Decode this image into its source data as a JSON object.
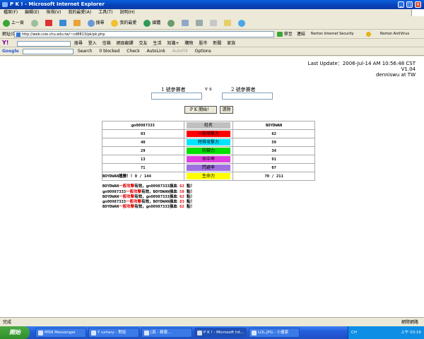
{
  "window": {
    "title": "P K ! - Microsoft Internet Explorer",
    "min": "_",
    "max": "□",
    "close": "×"
  },
  "menu": [
    "檔案(F)",
    "編輯(E)",
    "檢視(V)",
    "我的最愛(A)",
    "工具(T)",
    "說明(H)"
  ],
  "toolbar": {
    "back": "上一頁",
    "search": "搜尋",
    "favorites": "我的最愛",
    "media": "媒體"
  },
  "address": {
    "label": "網址(D)",
    "url": "http://web.csie.chu.edu.tw/~cd8813/pk/pk.php",
    "go": "移至",
    "links": "連結",
    "norton_security": "Norton Internet Security",
    "norton_av": "Norton AntiVirus"
  },
  "yahoo_bar": {
    "search": "搜尋",
    "signin": "登入",
    "mail": "信箱",
    "translate": "網頁翻譯",
    "shopping": "交友",
    "life": "生活",
    "knowledge": "知識+",
    "buy": "購物",
    "stock": "股市",
    "news": "新聞",
    "family": "家族"
  },
  "google_bar": {
    "label": "Google",
    "search": "Search",
    "blocked": "0 blocked",
    "check": "Check",
    "autolink": "AutoLink",
    "autofill": "AutoFill",
    "options": "Options"
  },
  "page": {
    "last_update": "Last Update：2006-Jul-14    AM 10:56:48 CST",
    "version": "V1.04",
    "author": "denniswu at TW",
    "p1_label": "1 號參賽者",
    "vs": "v s",
    "p2_label": "2 號參賽者",
    "pk_button": "P K 開始！",
    "clear_button": "清除",
    "table": {
      "header": {
        "p1": "gn00987333",
        "name": "姓名",
        "p2": "BOYDWAN"
      },
      "rows": [
        {
          "p1": "83",
          "attr": "一般攻擊力",
          "color": "#ff0000",
          "p2": "62"
        },
        {
          "p1": "40",
          "attr": "特殊攻擊力",
          "color": "#00e5ff",
          "p2": "59"
        },
        {
          "p1": "29",
          "attr": "防禦力",
          "color": "#00e000",
          "p2": "34"
        },
        {
          "p1": "13",
          "attr": "命中率",
          "color": "#e040e0",
          "p2": "91"
        },
        {
          "p1": "71",
          "attr": "閃避率",
          "color": "#a070e0",
          "p2": "07"
        },
        {
          "p1": "0  /  144",
          "attr": "生命力",
          "color": "#ffff00",
          "p2": "70  /  211"
        }
      ],
      "header_color": "#c0c0c0"
    },
    "winner": "BOYDWAN獲勝！！",
    "log": [
      {
        "a": "BOYDWAN",
        "b": "一般攻擊",
        "c": "有效，gn00987333損血",
        "d": "62",
        "e": "點！"
      },
      {
        "a": "gn00987333",
        "b": "一般攻擊",
        "c": "有效，BOYDWAN損血",
        "d": "58",
        "e": "點！"
      },
      {
        "a": "BOYDWAN",
        "b": "一般攻擊",
        "c": "有效，gn00987333損血",
        "d": "62",
        "e": "點！"
      },
      {
        "a": "gn00987333",
        "b": "一般攻擊",
        "c": "有效，BOYDWAN損血",
        "d": "83",
        "e": "點！"
      },
      {
        "a": "BOYDWAN",
        "b": "一般攻擊",
        "c": "有效，gn00987333損血",
        "d": "62",
        "e": "點！"
      }
    ]
  },
  "status": {
    "text": "完成",
    "zone": "網際網路"
  },
  "taskbar": {
    "start": "開始",
    "tasks": [
      "MSN Messenger",
      "Y ushary - 對話",
      "[真 - 精靈...",
      "P K ! - Microsoft Int...",
      "LOL.JPG - 小畫家"
    ],
    "tray": {
      "lang": "CH",
      "time": "上午 03:16"
    }
  }
}
